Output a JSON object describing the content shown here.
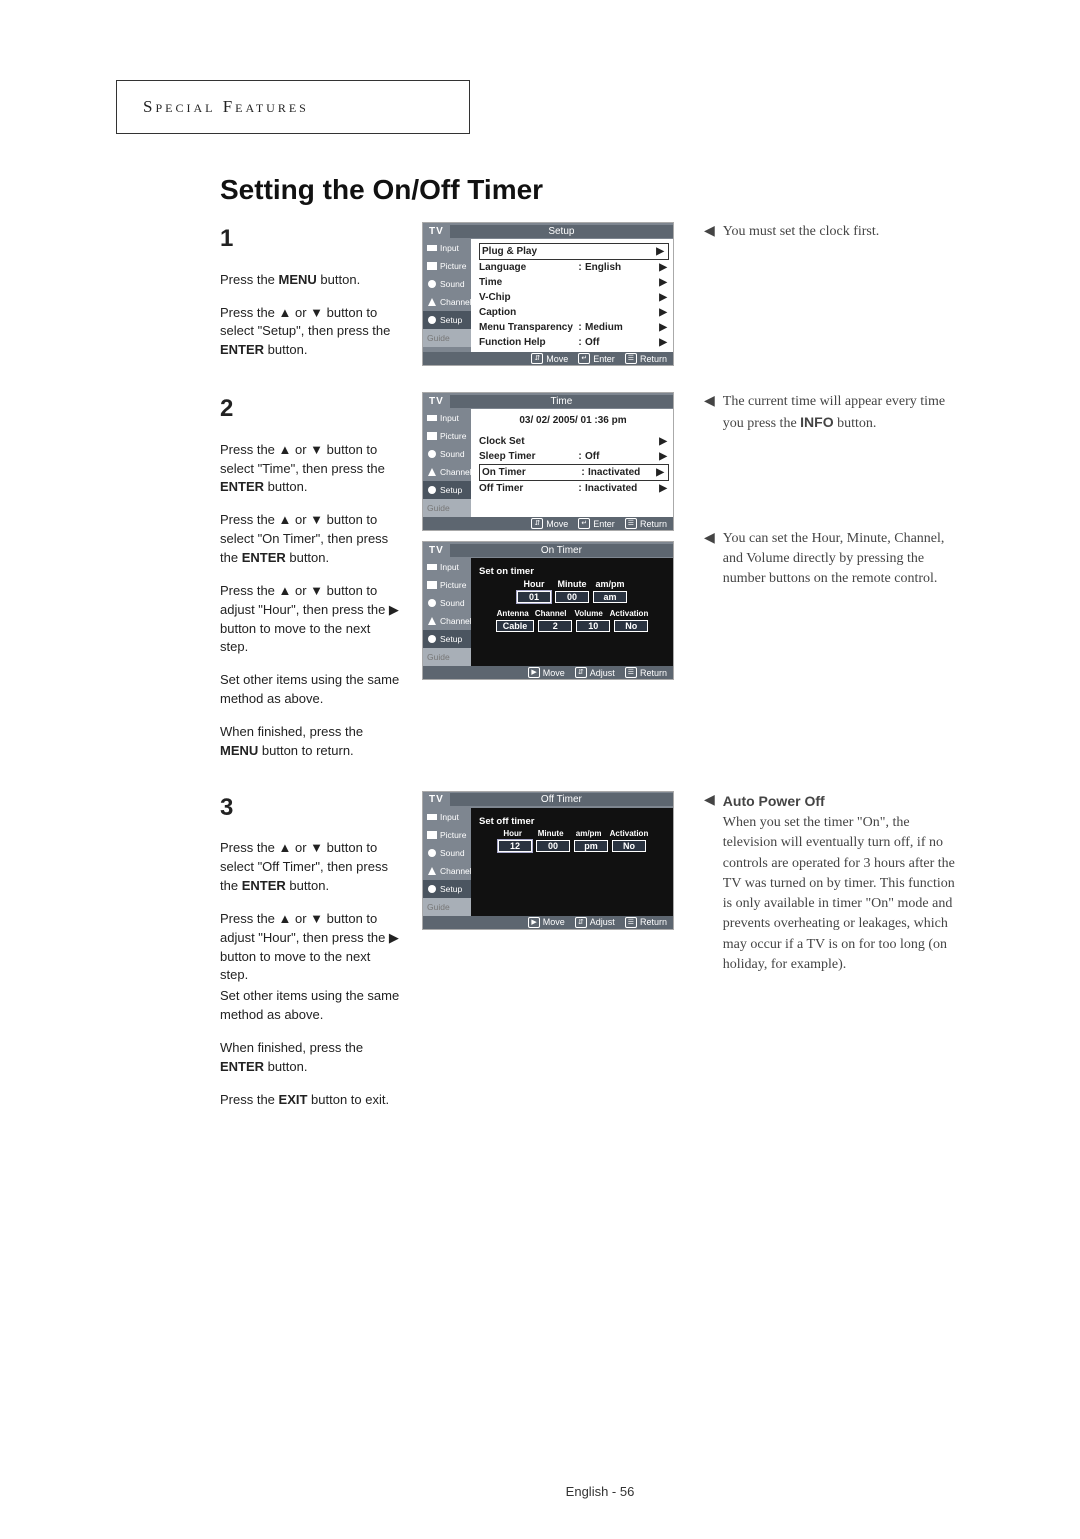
{
  "header": "Special Features",
  "title": "Setting the On/Off Timer",
  "footer": "English - 56",
  "sidebar_items": [
    "Input",
    "Picture",
    "Sound",
    "Channel",
    "Setup",
    "Guide"
  ],
  "osd_footer": {
    "move": "Move",
    "enter": "Enter",
    "return": "Return",
    "adjust": "Adjust"
  },
  "step1": {
    "num": "1",
    "p1a": "Press the ",
    "p1b": "MENU",
    "p1c": " button.",
    "p2": "Press the ▲ or ▼ button to select \"Setup\", then press the ",
    "p2b": "ENTER",
    "p2c": " button.",
    "osd": {
      "tv": "TV",
      "tab": "Setup",
      "rows": [
        {
          "label": "Plug & Play",
          "val": "",
          "sel": true
        },
        {
          "label": "Language",
          "val": "English"
        },
        {
          "label": "Time",
          "val": ""
        },
        {
          "label": "V-Chip",
          "val": ""
        },
        {
          "label": "Caption",
          "val": ""
        },
        {
          "label": "Menu Transparency",
          "val": "Medium"
        },
        {
          "label": "Function Help",
          "val": "Off"
        }
      ]
    },
    "note": "You must set the clock first."
  },
  "step2": {
    "num": "2",
    "p1": "Press the ▲ or ▼ button to select \"Time\", then press the ",
    "p1b": "ENTER",
    "p1c": " button.",
    "p2": "Press the ▲ or ▼ button to select \"On Timer\", then press the ",
    "p2b": "ENTER",
    "p2c": " button.",
    "p3": "Press the ▲ or ▼ button to adjust \"Hour\", then press the ▶ button to move to the next step.",
    "p4": "Set other items using the same method as above.",
    "p5a": "When finished, press the ",
    "p5b": "MENU",
    "p5c": " button to return.",
    "osd_time": {
      "tv": "TV",
      "tab": "Time",
      "datetime": "03/ 02/ 2005/ 01 :36  pm",
      "rows": [
        {
          "label": "Clock Set",
          "val": ""
        },
        {
          "label": "Sleep Timer",
          "val": "Off"
        },
        {
          "label": "On Timer",
          "val": "Inactivated",
          "sel": true
        },
        {
          "label": "Off Timer",
          "val": "Inactivated"
        }
      ]
    },
    "osd_on": {
      "tv": "TV",
      "tab": "On Timer",
      "title": "Set on timer",
      "headers1": [
        "Hour",
        "Minute",
        "am/pm"
      ],
      "row1": [
        "01",
        "00",
        "am"
      ],
      "headers2": [
        "Antenna",
        "Channel",
        "Volume",
        "Activation"
      ],
      "row2": [
        "Cable",
        "2",
        "10",
        "No"
      ]
    },
    "note1": "The current time will appear every time you press the ",
    "note1b": "INFO",
    "note1c": " button.",
    "note2": "You can set the Hour, Minute, Channel, and Volume directly by pressing the number buttons on the remote control."
  },
  "step3": {
    "num": "3",
    "p1": "Press the ▲ or ▼ button to select \"Off Timer\", then press the ",
    "p1b": "ENTER",
    "p1c": " button.",
    "p2": "Press the ▲ or ▼ button to adjust \"Hour\", then press the ▶ button to move to the next step.",
    "p3": "Set other items using the same method as above.",
    "p4a": "When finished, press the ",
    "p4b": "ENTER",
    "p4c": " button.",
    "p5a": "Press the ",
    "p5b": "EXIT",
    "p5c": " button to exit.",
    "osd_off": {
      "tv": "TV",
      "tab": "Off Timer",
      "title": "Set off timer",
      "headers": [
        "Hour",
        "Minute",
        "am/pm",
        "Activation"
      ],
      "row": [
        "12",
        "00",
        "pm",
        "No"
      ]
    },
    "note_title": "Auto Power Off",
    "note_body": "When you set the timer \"On\", the television will eventually turn off, if no controls are operated for 3 hours after the TV was turned on by timer. This function is only available in timer \"On\" mode and prevents overheating or leakages, which may occur if a TV is on for too long (on holiday, for example)."
  }
}
